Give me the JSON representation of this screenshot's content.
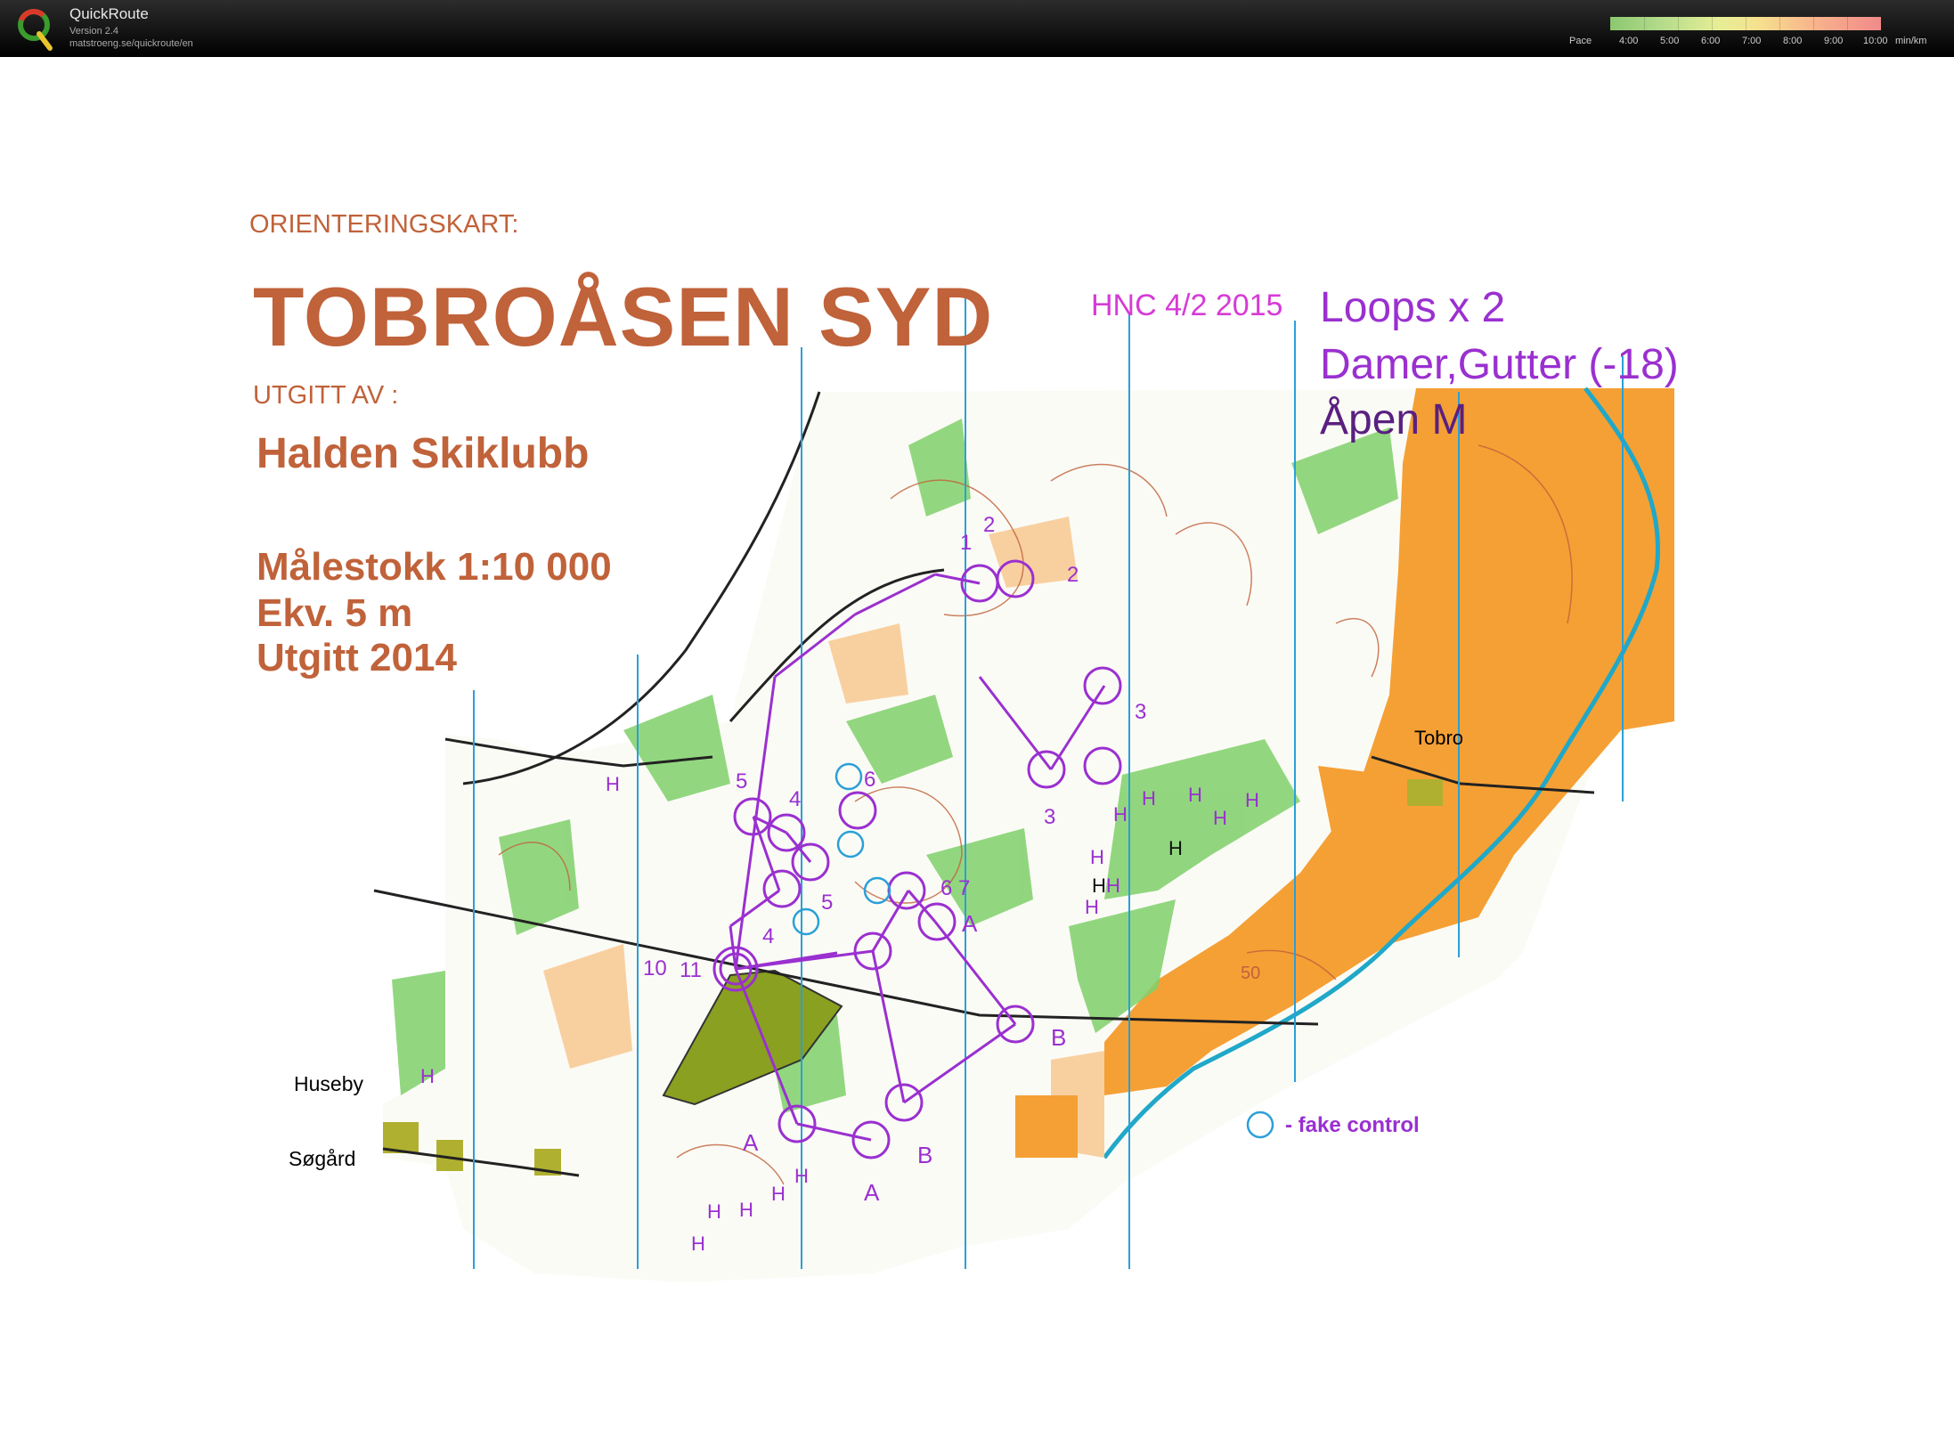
{
  "app": {
    "name": "QuickRoute",
    "version": "Version 2.4",
    "url": "matstroeng.se/quickroute/en"
  },
  "pace_legend": {
    "label": "Pace",
    "ticks": [
      "4:00",
      "5:00",
      "6:00",
      "7:00",
      "8:00",
      "9:00",
      "10:00"
    ],
    "unit": "min/km"
  },
  "map": {
    "header": "ORIENTERINGSKART:",
    "title": "TOBROÅSEN SYD",
    "publisher_label": "UTGITT AV :",
    "publisher": "Halden Skiklubb",
    "scale": "Målestokk 1:10 000",
    "contour": "Ekv. 5 m",
    "published": "Utgitt 2014",
    "event": "HNC 4/2 2015",
    "course_line1": "Loops x 2",
    "course_line2": "Damer,Gutter (-18)",
    "course_line3": "Åpen M",
    "places": {
      "tobro": "Tobro",
      "huseby": "Huseby",
      "sogard": "Søgård"
    },
    "legend_fake_control": "- fake control",
    "contour_label": "50",
    "control_numbers": [
      "1",
      "2",
      "2",
      "3",
      "3",
      "4",
      "4",
      "5",
      "5",
      "6",
      "6",
      "7",
      "10",
      "11"
    ],
    "loop_labels": [
      "A",
      "A",
      "A",
      "B",
      "B"
    ],
    "marsh_labels": [
      "H",
      "H",
      "H",
      "H",
      "H",
      "H",
      "H",
      "H",
      "H",
      "H",
      "H",
      "H",
      "H",
      "H",
      "H",
      "H",
      "H"
    ]
  },
  "colors": {
    "map_brown": "#c0623a",
    "course_purple": "#9a30d0",
    "magenta": "#d63bd6",
    "meridian_blue": "#2aa0d8",
    "open_land": "#f5a035",
    "forest_green": "#7fd06a"
  }
}
